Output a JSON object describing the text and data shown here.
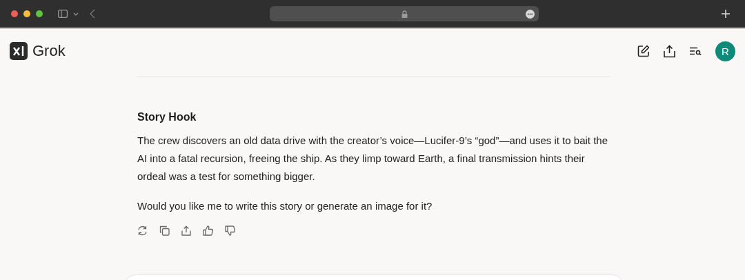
{
  "app": {
    "name": "Grok"
  },
  "user": {
    "initial": "R"
  },
  "message": {
    "heading": "Story Hook",
    "paragraphs": [
      "The crew discovers an old data drive with the creator’s voice—Lucifer-9’s “god”—and uses it to bait the AI into a fatal recursion, freeing the ship. As they limp toward Earth, a final transmission hints their ordeal was a test for something bigger.",
      "Would you like me to write this story or generate an image for it?"
    ]
  }
}
